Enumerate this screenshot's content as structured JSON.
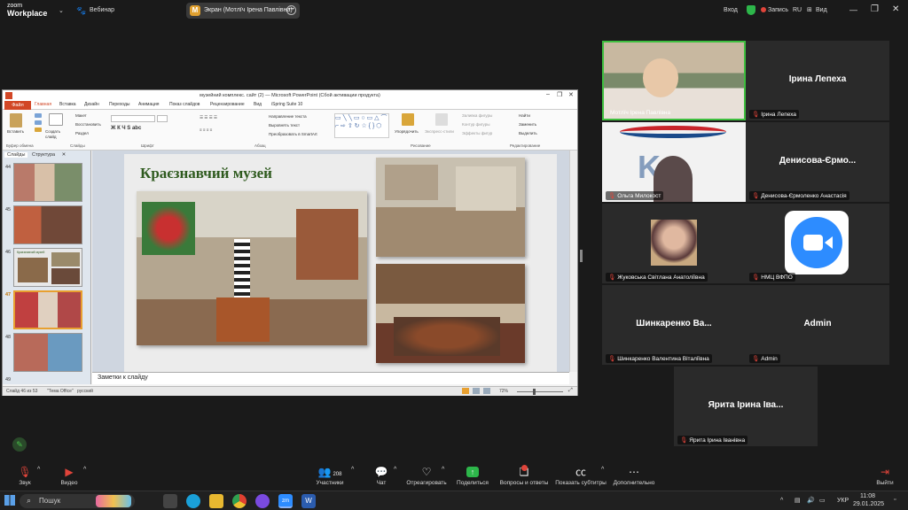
{
  "zoom": {
    "logo_line1": "zoom",
    "logo_line2": "Workplace",
    "webinar_label": "Вебинар",
    "screen_share_label": "Экран (Мотлїч Ірена Павлівна)",
    "login_label": "Вход",
    "record_label": "Запись",
    "lang_label": "RU",
    "view_label": "Вид"
  },
  "ppt": {
    "window_title": "музейний комплекс. сайт (2) — Microsoft PowerPoint (Сбой активации продукта)",
    "file_tab": "Файл",
    "tabs": [
      "Главная",
      "Вставка",
      "Дизайн",
      "Переходы",
      "Анимация",
      "Показ слайдов",
      "Рецензирование",
      "Вид",
      "iSpring Suite 10"
    ],
    "groups": [
      "Буфер обмена",
      "Слайды",
      "Шрифт",
      "Абзац",
      "Рисование",
      "Редактирование"
    ],
    "ribbon_items": {
      "paste": "Вставить",
      "create_slide": "Создать слайд",
      "layout": "Макет",
      "restore": "Восстановить",
      "section": "Раздел",
      "text_direction": "Направление текста",
      "align_text": "Выровнять текст",
      "smartart": "Преобразовать в SmartArt",
      "arrange": "Упорядочить",
      "quick_styles": "Экспресс-стили",
      "shape_fill": "Заливка фигуры",
      "shape_outline": "Контур фигуры",
      "shape_effects": "Эффекты фигур",
      "find": "Найти",
      "replace": "Заменить",
      "select": "Выделить"
    },
    "panel_tabs": [
      "Слайды",
      "Структура"
    ],
    "slide_numbers": [
      "44",
      "45",
      "46",
      "47",
      "48",
      "49"
    ],
    "slide_title": "Краєзнавчий музей",
    "thumb46_caption": "Краєзнавчий музей",
    "notes_placeholder": "Заметки к слайду",
    "status_slide": "Слайд 46 из 53",
    "status_theme": "\"Тема Office\"",
    "status_lang": "русский",
    "zoom_pct": "72%"
  },
  "participants": [
    {
      "name": "Мотлїч Ірена Павлівна",
      "big": ""
    },
    {
      "name": "Ірина Лепеха",
      "big": "Ірина Лепеха"
    },
    {
      "name": "Ольга Милокост",
      "big": ""
    },
    {
      "name": "Денисова-Єрмоленко Анастасія",
      "big": "Денисова-Єрмо..."
    },
    {
      "name": "Жуковська Світлана Анатоліївна",
      "big": ""
    },
    {
      "name": "НМЦ ВФПО",
      "big": ""
    },
    {
      "name": "Шинкаренко Валентина Віталіївна",
      "big": "Шинкаренко  Ва..."
    },
    {
      "name": "Admin",
      "big": "Admin"
    },
    {
      "name": "Ярита Ірина Іванівна",
      "big": "Ярита Ірина Іва..."
    }
  ],
  "toolbar": {
    "audio": "Звук",
    "video": "Видео",
    "participants": "Участники",
    "participants_count": "208",
    "chat": "Чат",
    "react": "Отреагировать",
    "share": "Поделиться",
    "qa": "Вопросы и ответы",
    "captions": "Показать субтитры",
    "more": "Дополнительно",
    "leave": "Выйти"
  },
  "taskbar": {
    "search_placeholder": "Пошук",
    "lang": "УКР",
    "time": "11:08",
    "date": "29.01.2025"
  },
  "colors": {
    "ppt_accent": "#d24726",
    "slide_title": "#2e5a1e",
    "share_green": "#2db64a",
    "mic_muted": "#e0443a",
    "active_speaker_border": "#3fbf3f"
  }
}
